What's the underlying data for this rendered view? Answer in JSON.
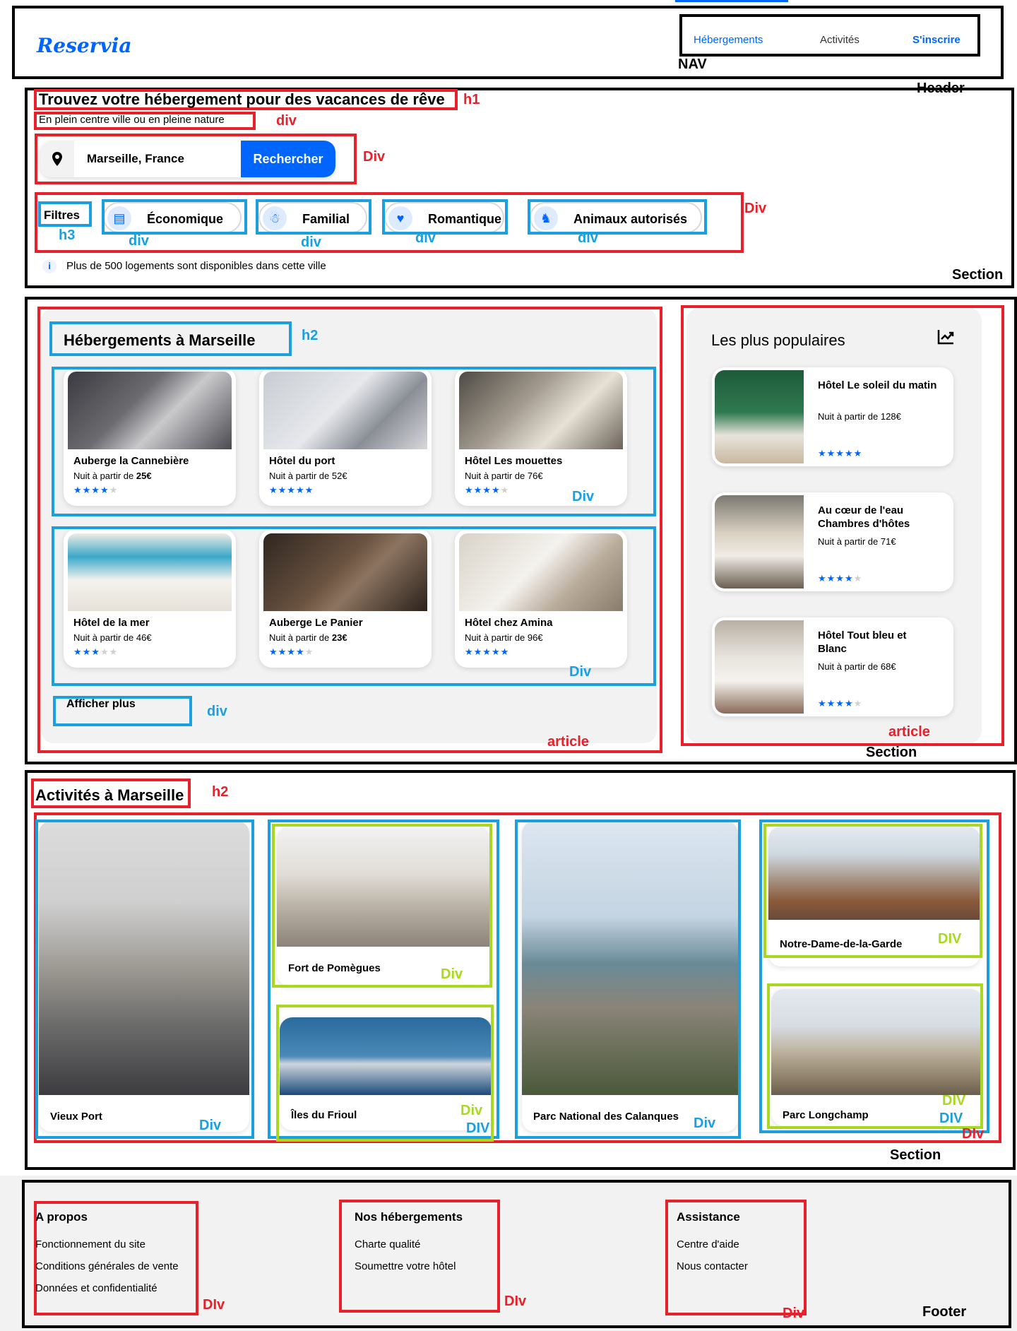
{
  "header": {
    "logo": "Reservia",
    "nav": [
      "Hébergements",
      "Activités",
      "S'inscrire"
    ]
  },
  "hero": {
    "title": "Trouvez votre hébergement pour des vacances de rêve",
    "subtitle": "En plein centre ville ou en pleine nature",
    "search_value": "Marseille, France",
    "search_button": "Rechercher",
    "filters_title": "Filtres",
    "filters": [
      "Économique",
      "Familial",
      "Romantique",
      "Animaux autorisés"
    ],
    "info_text": "Plus de 500 logements sont disponibles dans cette ville"
  },
  "lodging": {
    "title": "Hébergements à Marseille",
    "cards": [
      {
        "name": "Auberge la Cannebière",
        "price_prefix": "Nuit à partir de ",
        "price": "25€",
        "stars": 4
      },
      {
        "name": "Hôtel du port",
        "price_prefix": "Nuit à partir de ",
        "price": "52€",
        "stars": 5
      },
      {
        "name": "Hôtel Les mouettes",
        "price_prefix": "Nuit à partir de ",
        "price": "76€",
        "stars": 4
      },
      {
        "name": "Hôtel de la mer",
        "price_prefix": "Nuit à partir de ",
        "price": "46€",
        "stars": 3
      },
      {
        "name": "Auberge Le Panier",
        "price_prefix": "Nuit à partir de ",
        "price": "23€",
        "stars": 4
      },
      {
        "name": "Hôtel chez Amina",
        "price_prefix": "Nuit à partir de ",
        "price": "96€",
        "stars": 5
      }
    ],
    "show_more": "Afficher plus"
  },
  "popular": {
    "title": "Les plus populaires",
    "cards": [
      {
        "name": "Hôtel Le soleil du matin",
        "price": "Nuit à partir de 128€",
        "stars": 5
      },
      {
        "name": "Au cœur de l'eau Chambres d'hôtes",
        "price": "Nuit à partir de 71€",
        "stars": 4
      },
      {
        "name": "Hôtel Tout bleu et Blanc",
        "price": "Nuit à partir de 68€",
        "stars": 4
      }
    ]
  },
  "activities": {
    "title": "Activités à Marseille",
    "items": [
      "Vieux Port",
      "Fort de Pomègues",
      "Îles du Frioul",
      "Parc National des Calanques",
      "Notre-Dame-de-la-Garde",
      "Parc Longchamp"
    ]
  },
  "footer": {
    "columns": [
      {
        "title": "A propos",
        "links": [
          "Fonctionnement du site",
          "Conditions générales de vente",
          "Données et confidentialité"
        ]
      },
      {
        "title": "Nos hébergements",
        "links": [
          "Charte qualité",
          "Soumettre votre hôtel"
        ]
      },
      {
        "title": "Assistance",
        "links": [
          "Centre d'aide",
          "Nous contacter"
        ]
      }
    ]
  },
  "annotations": {
    "nav": "NAV",
    "header": "Header",
    "h1": "h1",
    "div": "div",
    "Div": "Div",
    "h3": "h3",
    "h2": "h2",
    "section": "Section",
    "article": "article",
    "DIV": "DIV",
    "DIv": "DIv",
    "footer": "Footer"
  },
  "colors": {
    "brand": "#0065fc",
    "red_annotation": "#e8202a",
    "blue_annotation": "#1aa0e0",
    "green_annotation": "#a8d820",
    "panel": "#f2f2f2"
  }
}
